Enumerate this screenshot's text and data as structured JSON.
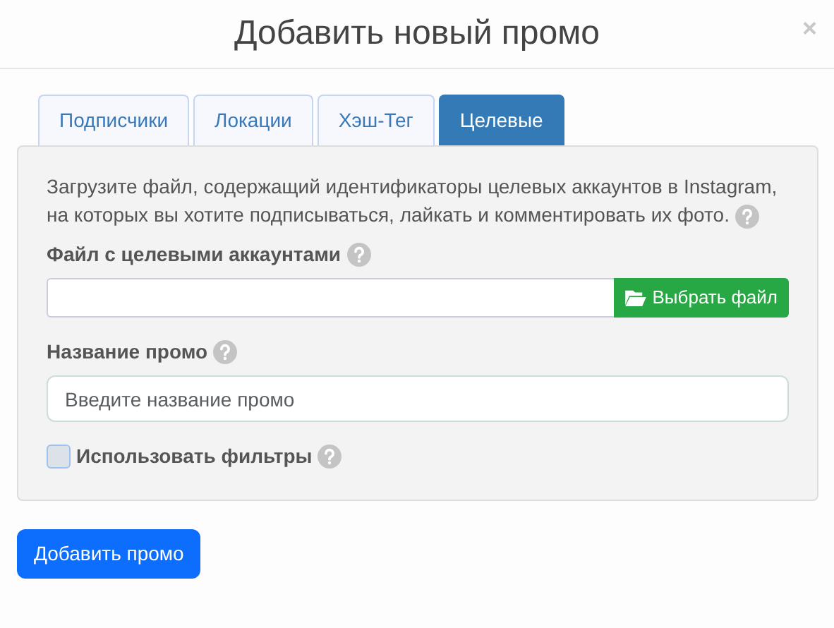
{
  "dialog": {
    "title": "Добавить новый промо",
    "close": "×"
  },
  "tabs": [
    {
      "label": "Подписчики",
      "selected": false
    },
    {
      "label": "Локации",
      "selected": false
    },
    {
      "label": "Хэш-Тег",
      "selected": false
    },
    {
      "label": "Целевые",
      "selected": true
    }
  ],
  "panel": {
    "description": "Загрузите файл, содержащий идентификаторы целевых аккаунтов в Instagram, на которых вы хотите подписываться, лайкать и комментировать их фото.",
    "file_label": "Файл с целевыми аккаунтами",
    "file_button": "Выбрать файл",
    "name_label": "Название промо",
    "name_placeholder": "Введите название промо",
    "filters": {
      "label": "Использовать фильтры",
      "checked": false
    }
  },
  "submit": "Добавить промо"
}
